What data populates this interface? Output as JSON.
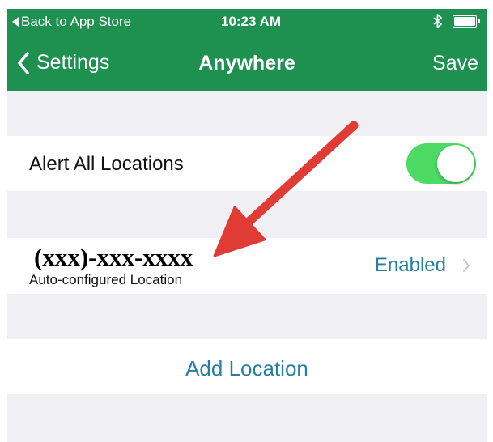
{
  "status_bar": {
    "back_to_app": "Back to App Store",
    "time": "10:23 AM"
  },
  "nav": {
    "back_label": "Settings",
    "title": "Anywhere",
    "save_label": "Save"
  },
  "alert_all": {
    "label": "Alert All Locations",
    "enabled": true
  },
  "location": {
    "number": "(xxx)-xxx-xxxx",
    "subtitle": "Auto-configured Location",
    "status": "Enabled"
  },
  "add_location": {
    "label": "Add Location"
  },
  "colors": {
    "header_bg": "#1e9151",
    "toggle_on": "#4cd964",
    "link_blue": "#267fa1",
    "annotation_arrow": "#e03b35",
    "page_bg": "#efeff4"
  },
  "icons": {
    "status_back": "left-triangle-icon",
    "bluetooth": "bluetooth-icon",
    "battery": "battery-icon",
    "nav_back": "chevron-left-icon",
    "row_disclosure": "chevron-right-icon",
    "annotation": "red-arrow-icon"
  }
}
